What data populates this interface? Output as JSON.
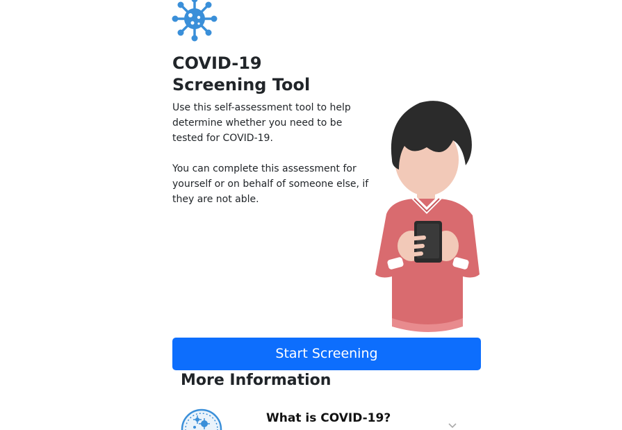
{
  "header": {
    "logo_icon": "virus-icon",
    "title_line1": "COVID-19",
    "title_line2": "Screening Tool"
  },
  "intro": {
    "paragraph1": "Use this self-assessment tool to help determine whether you need to be tested for COVID-19.",
    "paragraph2": "You can complete this assessment for yourself or on behalf of someone else, if they are not able."
  },
  "illustration": {
    "icon": "person-with-phone-illustration"
  },
  "actions": {
    "start_label": "Start Screening"
  },
  "more_info": {
    "heading": "More Information",
    "items": [
      {
        "title": "What is COVID-19?",
        "icon": "virus-badge-icon"
      }
    ]
  },
  "colors": {
    "primary": "#0d6efd",
    "logo_blue": "#3a8fd9",
    "sweater": "#d96b6f",
    "hair": "#2b2b2b",
    "skin": "#f2c9b8"
  }
}
